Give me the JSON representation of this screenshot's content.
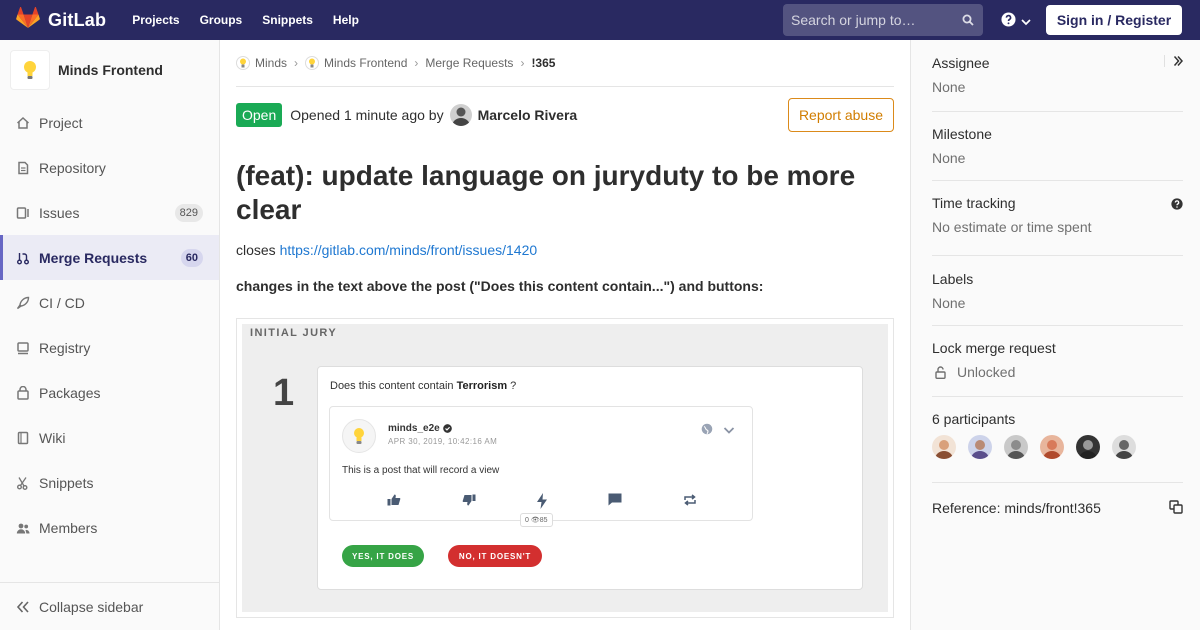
{
  "navbar": {
    "brand": "GitLab",
    "links": [
      "Projects",
      "Groups",
      "Snippets",
      "Help"
    ],
    "search_placeholder": "Search or jump to…",
    "signin_label": "Sign in / Register"
  },
  "sidebar": {
    "project_name": "Minds Frontend",
    "items": [
      {
        "label": "Project",
        "icon": "home-icon"
      },
      {
        "label": "Repository",
        "icon": "doc-icon"
      },
      {
        "label": "Issues",
        "icon": "issues-icon",
        "count": "829"
      },
      {
        "label": "Merge Requests",
        "icon": "merge-request-icon",
        "count": "60",
        "active": true
      },
      {
        "label": "CI / CD",
        "icon": "rocket-icon"
      },
      {
        "label": "Registry",
        "icon": "container-icon"
      },
      {
        "label": "Packages",
        "icon": "package-icon"
      },
      {
        "label": "Wiki",
        "icon": "book-icon"
      },
      {
        "label": "Snippets",
        "icon": "scissors-icon"
      },
      {
        "label": "Members",
        "icon": "users-icon"
      }
    ],
    "collapse_label": "Collapse sidebar"
  },
  "breadcrumb": {
    "items": [
      "Minds",
      "Minds Frontend",
      "Merge Requests",
      "!365"
    ]
  },
  "mr": {
    "status": "Open",
    "opened_text": "Opened 1 minute ago by",
    "author": "Marcelo Rivera",
    "report_label": "Report abuse",
    "title": "(feat): update language on juryduty to be more clear",
    "closes_prefix": "closes ",
    "closes_link": "https://gitlab.com/minds/front/issues/1420",
    "changes_text": "changes in the text above the post (\"Does this content contain...\") and buttons:"
  },
  "screenshot": {
    "heading": "INITIAL JURY",
    "number": "1",
    "question_prefix": "Does this content contain ",
    "question_term": "Terrorism",
    "question_suffix": " ?",
    "post_user": "minds_e2e",
    "post_date": "APR 30, 2019, 10:42:16 AM",
    "post_text": "This is a post that will record a view",
    "counter_text": "0 👁85",
    "yes_label": "YES, IT DOES",
    "no_label": "NO, IT DOESN'T"
  },
  "right_sidebar": {
    "assignee_label": "Assignee",
    "assignee_value": "None",
    "milestone_label": "Milestone",
    "milestone_value": "None",
    "time_label": "Time tracking",
    "time_value": "No estimate or time spent",
    "labels_label": "Labels",
    "labels_value": "None",
    "lock_label": "Lock merge request",
    "lock_value": "Unlocked",
    "participants_label": "6 participants",
    "reference_label": "Reference: minds/front!365"
  },
  "colors": {
    "navbar": "#292961",
    "open_badge": "#1aaa55",
    "report_border": "#db8a1a",
    "link": "#1f78d1",
    "yes_button": "#36a446",
    "no_button": "#d32f2f"
  }
}
